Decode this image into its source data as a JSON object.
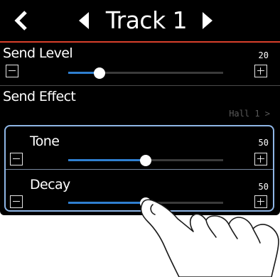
{
  "header": {
    "title": "Track 1",
    "back_icon": "chevron-left-icon",
    "prev_icon": "triangle-left-icon",
    "next_icon": "triangle-right-icon"
  },
  "rows": {
    "send_level": {
      "label": "Send Level",
      "value": "20",
      "level": 20
    },
    "send_effect": {
      "label": "Send Effect",
      "value": "Hall 1 >"
    },
    "tone": {
      "label": "Tone",
      "value": "50",
      "level": 50
    },
    "decay": {
      "label": "Decay",
      "value": "50",
      "level": 50
    }
  },
  "colors": {
    "accent_divider": "#d9402b",
    "slider_fill": "#2f7fd0",
    "focus_frame": "#8fb6e6"
  }
}
